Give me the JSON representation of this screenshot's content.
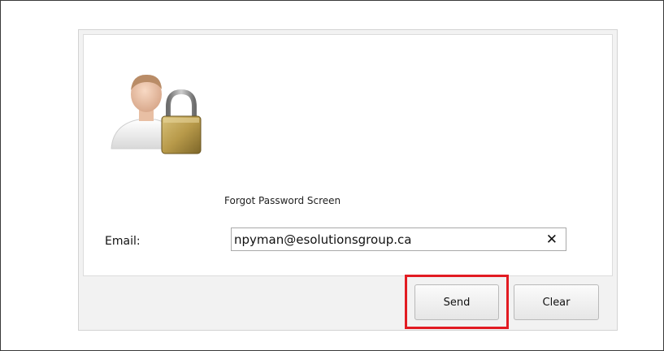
{
  "dialog": {
    "title": "Forgot Password Screen",
    "email_label": "Email:",
    "email_value": "npyman@esolutionsgroup.ca",
    "clear_field_icon": "close-icon",
    "avatar_icon": "user-lock-icon"
  },
  "buttons": {
    "send_label": "Send",
    "clear_label": "Clear"
  },
  "colors": {
    "highlight": "#e21b22",
    "lock_gold": "#b89a4a"
  }
}
